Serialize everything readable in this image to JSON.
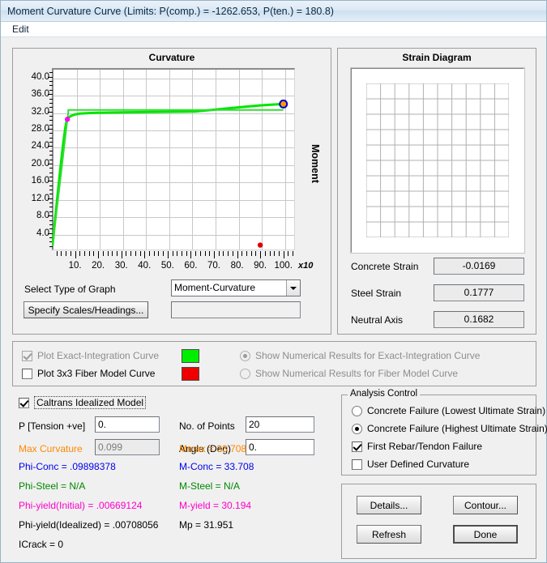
{
  "window": {
    "title": "Moment Curvature Curve (Limits:  P(comp.) = -1262.653, P(ten.) = 180.8)",
    "menu": [
      "Edit"
    ]
  },
  "chart_panel": {
    "title": "Curvature",
    "select_graph_label": "Select Type of Graph",
    "graph_type_value": "Moment-Curvature",
    "specify_button": "Specify Scales/Headings...",
    "heading_value": ""
  },
  "chart_data": {
    "type": "line",
    "title": "Curvature",
    "xlabel": "",
    "ylabel": "Moment",
    "x_multiplier": "x10",
    "xlim": [
      0,
      105
    ],
    "ylim": [
      0,
      42
    ],
    "xticks": [
      "10.",
      "20.",
      "30.",
      "40.",
      "50.",
      "60.",
      "70.",
      "80.",
      "90.",
      "100."
    ],
    "xtick_values": [
      10,
      20,
      30,
      40,
      50,
      60,
      70,
      80,
      90,
      100
    ],
    "yticks": [
      "4.0",
      "8.0",
      "12.0",
      "16.0",
      "20.0",
      "24.0",
      "28.0",
      "32.0",
      "36.0",
      "40.0"
    ],
    "ytick_values": [
      4,
      8,
      12,
      16,
      20,
      24,
      28,
      32,
      36,
      40
    ],
    "grid": true,
    "legend": "none",
    "series": [
      {
        "name": "Exact-Integration Curve",
        "color": "#00e500",
        "x": [
          0.3,
          1.0,
          1.8,
          2.6,
          3.4,
          4.2,
          5.0,
          5.8,
          6.3,
          6.7,
          7.2,
          7.8,
          8.4,
          9.0,
          10.0,
          12.0,
          15.0,
          20.0,
          26.0,
          33.0,
          40.0,
          48.0,
          56.0,
          62.0,
          66.0,
          72.0,
          78.0,
          84.0,
          90.0,
          96.0,
          100.0
        ],
        "y": [
          1.0,
          5.0,
          9.2,
          13.4,
          17.4,
          21.4,
          25.0,
          28.2,
          29.6,
          30.2,
          30.6,
          30.8,
          31.0,
          31.1,
          31.3,
          31.5,
          31.6,
          31.7,
          31.75,
          31.8,
          31.85,
          31.9,
          31.95,
          32.0,
          32.2,
          32.5,
          32.8,
          33.1,
          33.4,
          33.6,
          33.708
        ]
      },
      {
        "name": "Caltrans Idealized Model",
        "color": "#33dd33",
        "x": [
          0.3,
          7.1,
          7.1,
          100.0
        ],
        "y": [
          1.0,
          31.951,
          32.35,
          32.35
        ]
      }
    ],
    "markers": [
      {
        "name": "yield-point",
        "x": 6.7,
        "y": 30.194,
        "color": "#ff00ff",
        "ring": ""
      },
      {
        "name": "ultimate-point",
        "x": 100.0,
        "y": 33.708,
        "color": "#ff9900",
        "ring": "#0000cc"
      },
      {
        "name": "fiber-model-point",
        "x": 90.0,
        "y": 1.2,
        "color": "#dd0000",
        "ring": ""
      }
    ]
  },
  "strain_panel": {
    "title": "Strain Diagram",
    "rows": [
      {
        "label": "Concrete Strain",
        "value": "-0.0169"
      },
      {
        "label": "Steel Strain",
        "value": "0.1777"
      },
      {
        "label": "Neutral Axis",
        "value": "0.1682"
      }
    ]
  },
  "curve_options": {
    "exact": {
      "label": "Plot Exact-Integration Curve",
      "checked": true,
      "disabled": true,
      "color": "#00ee00"
    },
    "fiber": {
      "label": "Plot 3x3 Fiber Model Curve",
      "checked": false,
      "disabled": false,
      "color": "#ee0000"
    },
    "show_exact": {
      "label": "Show Numerical Results for Exact-Integration Curve",
      "selected": true,
      "disabled": true
    },
    "show_fiber": {
      "label": "Show Numerical Results for Fiber Model Curve",
      "selected": false,
      "disabled": true
    }
  },
  "model": {
    "caltrans_label": "Caltrans Idealized Model",
    "caltrans_checked": true,
    "p_tension_label": "P [Tension +ve]",
    "p_tension_value": "0.",
    "max_curvature_label": "Max Curvature",
    "max_curvature_value": "0.099",
    "points_label": "No. of Points",
    "points_value": "20",
    "angle_label": "Angle (Deg)",
    "angle_value": "0.",
    "mmax_label": "Mmax = 33.708",
    "results": [
      {
        "left": "Phi-Conc = .09898378",
        "right": "M-Conc = 33.708",
        "color": "#0000ee"
      },
      {
        "left": "Phi-Steel = N/A",
        "right": "M-Steel = N/A",
        "color": "#008800"
      },
      {
        "left": "Phi-yield(Initial) = .00669124",
        "right": "M-yield = 30.194",
        "color": "#ff00cc"
      },
      {
        "left": "Phi-yield(Idealized) = .00708056",
        "right": "Mp = 31.951",
        "color": "#000000"
      },
      {
        "left": "ICrack =  0",
        "right": "",
        "color": "#000000"
      }
    ]
  },
  "analysis_control": {
    "legend": "Analysis Control",
    "options": [
      {
        "label": "Concrete Failure (Lowest Ultimate Strain)",
        "type": "radio",
        "selected": false
      },
      {
        "label": "Concrete Failure (Highest Ultimate Strain)",
        "type": "radio",
        "selected": true
      },
      {
        "label": "First Rebar/Tendon Failure",
        "type": "checkbox",
        "selected": true
      },
      {
        "label": "User Defined Curvature",
        "type": "checkbox",
        "selected": false
      }
    ]
  },
  "buttons": {
    "details": "Details...",
    "contour": "Contour...",
    "refresh": "Refresh",
    "done": "Done"
  },
  "colors": {
    "orange": "#ff8800",
    "blue": "#0000ee",
    "green": "#008800",
    "magenta": "#ff00cc"
  }
}
